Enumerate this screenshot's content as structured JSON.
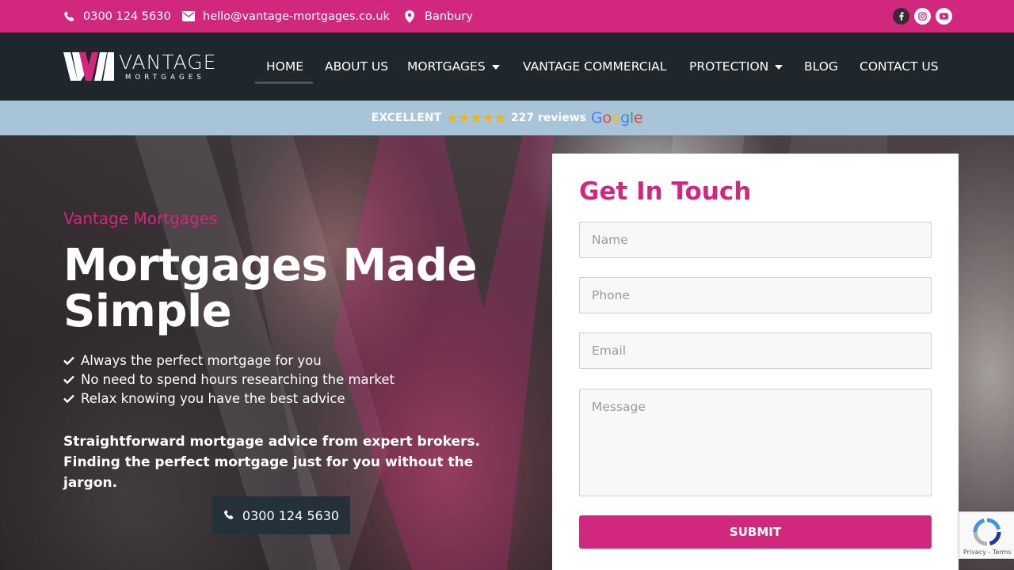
{
  "topbar": {
    "phone": "0300 124 5630",
    "email": "hello@vantage-mortgages.co.uk",
    "location": "Banbury",
    "social": [
      {
        "icon": "facebook-icon",
        "color": "#3a2a35"
      },
      {
        "icon": "instagram-icon",
        "color": "#ffffff"
      },
      {
        "icon": "youtube-icon",
        "color": "#ffffff"
      }
    ]
  },
  "logo": {
    "main": "VANTAGE",
    "sub": "MORTGAGES"
  },
  "nav": {
    "items": [
      {
        "label": "HOME",
        "active": true
      },
      {
        "label": "ABOUT US"
      },
      {
        "label": "MORTGAGES",
        "dropdown": true
      },
      {
        "label": "VANTAGE COMMERCIAL"
      },
      {
        "label": "PROTECTION",
        "dropdown": true
      },
      {
        "label": "BLOG"
      },
      {
        "label": "CONTACT US"
      }
    ]
  },
  "reviews": {
    "rating_label": "EXCELLENT",
    "stars": 5,
    "count_label": "227 reviews",
    "brand": "Google"
  },
  "hero": {
    "eyebrow": "Vantage Mortgages",
    "title": "Mortgages Made Simple",
    "bullets": [
      "Always the perfect mortgage for you",
      "No need to spend hours researching the market",
      "Relax knowing you have the best advice"
    ],
    "description": "Straightforward mortgage advice from expert brokers. Finding the perfect mortgage just for you without the jargon.",
    "call_button": "0300 124 5630"
  },
  "form": {
    "title": "Get In Touch",
    "name_placeholder": "Name",
    "phone_placeholder": "Phone",
    "email_placeholder": "Email",
    "message_placeholder": "Message",
    "submit_label": "SUBMIT"
  },
  "recaptcha": {
    "links": "Privacy - Terms"
  },
  "colors": {
    "brand_pink": "#d1287d",
    "nav_dark": "#1f272d",
    "review_bar": "#a7c4d8",
    "star": "#f5b50a"
  }
}
